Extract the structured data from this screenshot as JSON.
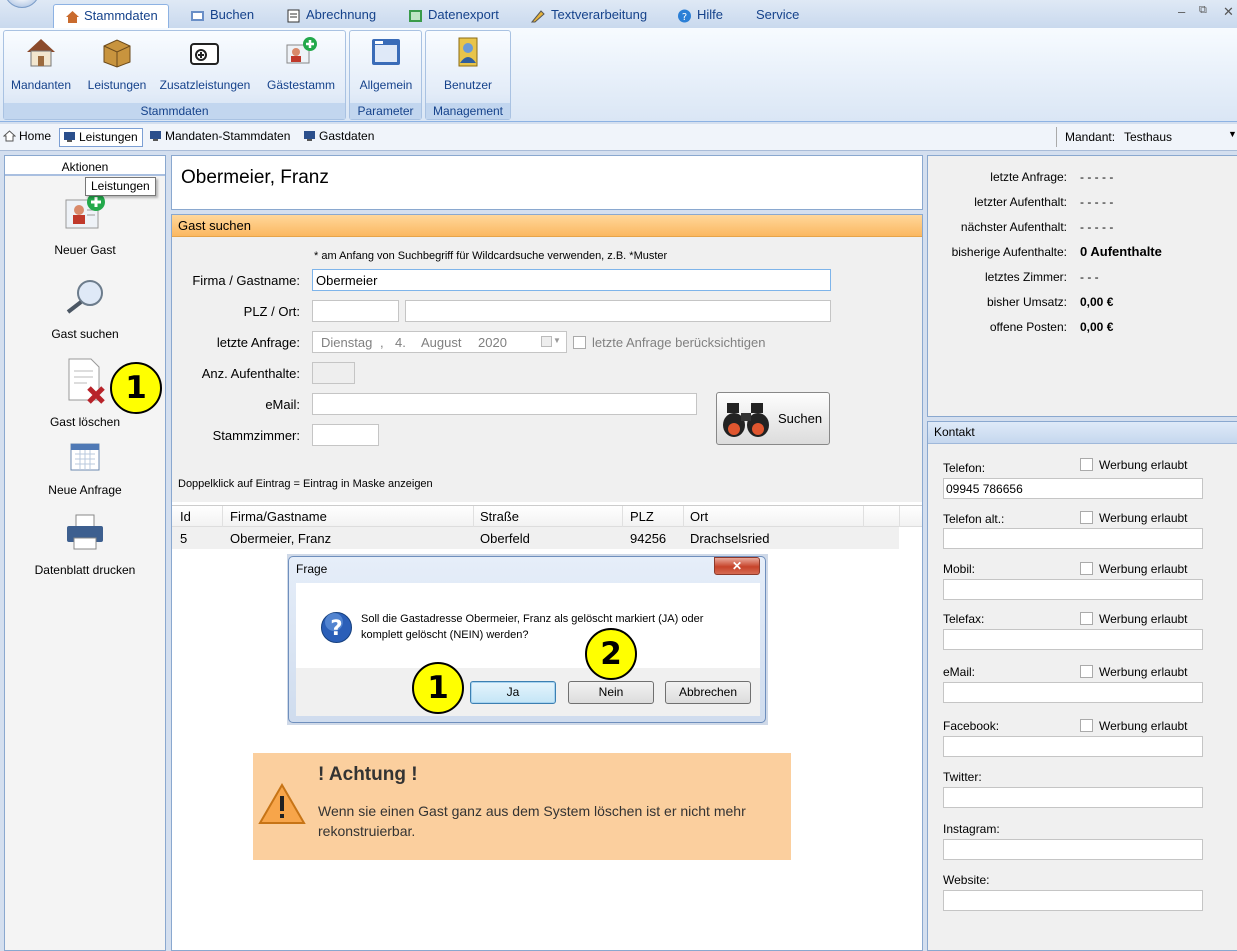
{
  "ribbon_tabs": [
    "Stammdaten",
    "Buchen",
    "Abrechnung",
    "Datenexport",
    "Textverarbeitung",
    "Hilfe",
    "Service"
  ],
  "window_controls": {
    "minimize": "–",
    "restore": "⧉",
    "close": "✕"
  },
  "ribbon": {
    "stammdaten_group": {
      "label": "Stammdaten",
      "buttons": [
        "Mandanten",
        "Leistungen",
        "Zusatzleistungen",
        "Gästestamm"
      ]
    },
    "parameter_group": {
      "label": "Parameter",
      "buttons": [
        "Allgemein"
      ]
    },
    "management_group": {
      "label": "Management",
      "buttons": [
        "Benutzer"
      ]
    }
  },
  "navbar": {
    "items": [
      "Home",
      "Leistungen",
      "Mandaten-Stammdaten",
      "Gastdaten"
    ],
    "mandant_label": "Mandant:",
    "mandant_value": "Testhaus"
  },
  "actions": {
    "title": "Aktionen",
    "tooltip": "Leistungen",
    "items": [
      "Neuer Gast",
      "Gast suchen",
      "Gast löschen",
      "Neue Anfrage",
      "Datenblatt drucken"
    ]
  },
  "guest_name": "Obermeier, Franz",
  "search": {
    "title": "Gast suchen",
    "note": "* am Anfang von Suchbegriff für Wildcardsuche verwenden, z.B. *Muster",
    "firma_label": "Firma / Gastname:",
    "firma_value": "Obermeier",
    "plz_label": "PLZ / Ort:",
    "anfrage_label": "letzte Anfrage:",
    "date": {
      "weekday": "Dienstag",
      "day": "4.",
      "month": "August",
      "year": "2020"
    },
    "anfrage_check_label": "letzte Anfrage berücksichtigen",
    "aufenthalte_label": "Anz. Aufenthalte:",
    "email_label": "eMail:",
    "zimmer_label": "Stammzimmer:",
    "button": "Suchen",
    "hint": "Doppelklick auf Eintrag = Eintrag in Maske anzeigen"
  },
  "grid": {
    "columns": [
      "Id",
      "Firma/Gastname",
      "Straße",
      "PLZ",
      "Ort"
    ],
    "rows": [
      [
        "5",
        "Obermeier, Franz",
        "Oberfeld",
        "94256",
        "Drachselsried"
      ]
    ]
  },
  "dialog": {
    "title": "Frage",
    "close": "✕",
    "message": "Soll die Gastadresse Obermeier, Franz als gelöscht markiert (JA) oder komplett gelöscht (NEIN) werden?",
    "buttons": [
      "Ja",
      "Nein",
      "Abbrechen"
    ]
  },
  "warning": {
    "title": "! Achtung !",
    "text": "Wenn sie einen Gast ganz aus dem System löschen ist er nicht mehr rekonstruierbar."
  },
  "callouts": [
    "1",
    "1",
    "2"
  ],
  "stats": [
    {
      "label": "letzte Anfrage:",
      "value": "- - - - -"
    },
    {
      "label": "letzter Aufenthalt:",
      "value": "- - - - -"
    },
    {
      "label": "nächster Aufenthalt:",
      "value": "- - - - -"
    },
    {
      "label": "bisherige Aufenthalte:",
      "value": "0 Aufenthalte"
    },
    {
      "label": "letztes Zimmer:",
      "value": "- - -"
    },
    {
      "label": "bisher Umsatz:",
      "value": "0,00 €"
    },
    {
      "label": "offene Posten:",
      "value": "0,00 €"
    }
  ],
  "kontakt": {
    "title": "Kontakt",
    "werbung_label": "Werbung erlaubt",
    "fields": [
      {
        "label": "Telefon:",
        "value": "09945 786656"
      },
      {
        "label": "Telefon alt.:",
        "value": ""
      },
      {
        "label": "Mobil:",
        "value": ""
      },
      {
        "label": "Telefax:",
        "value": ""
      },
      {
        "label": "eMail:",
        "value": ""
      },
      {
        "label": "Facebook:",
        "value": ""
      },
      {
        "label": "Twitter:",
        "value": ""
      },
      {
        "label": "Instagram:",
        "value": ""
      },
      {
        "label": "Website:",
        "value": ""
      }
    ]
  },
  "colors": {
    "accent_orange": "#fbb861",
    "warning_bg": "#fbcf9e",
    "callout_yellow": "#ffff00",
    "ribbon_text": "#15428b"
  }
}
